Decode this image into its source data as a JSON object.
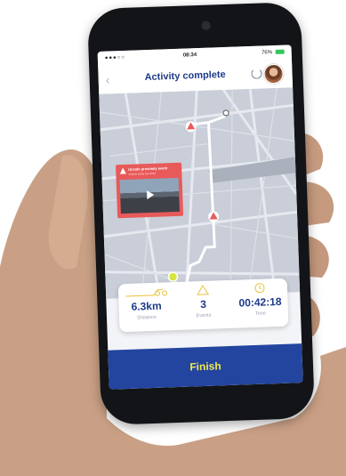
{
  "status_bar": {
    "signal": "●●●○○",
    "time": "08:34",
    "battery": "76%"
  },
  "header": {
    "title": "Activity complete",
    "back_icon": "chevron-left-icon"
  },
  "alert": {
    "title": "Unsafe proximity event",
    "subtitle": "Vehicle came too close"
  },
  "stats": [
    {
      "value": "6.3km",
      "label": "Distance",
      "icon": "bike-icon"
    },
    {
      "value": "3",
      "label": "Events",
      "icon": "warning-icon"
    },
    {
      "value": "00:42:18",
      "label": "Time",
      "icon": "clock-icon"
    }
  ],
  "finish_label": "Finish",
  "colors": {
    "brand": "#1e3a8a",
    "finish_bg": "#2345a0",
    "finish_text": "#f2e94e",
    "alert": "#e85a5a",
    "route": "#ffffff",
    "marker": "#d6e63a"
  }
}
